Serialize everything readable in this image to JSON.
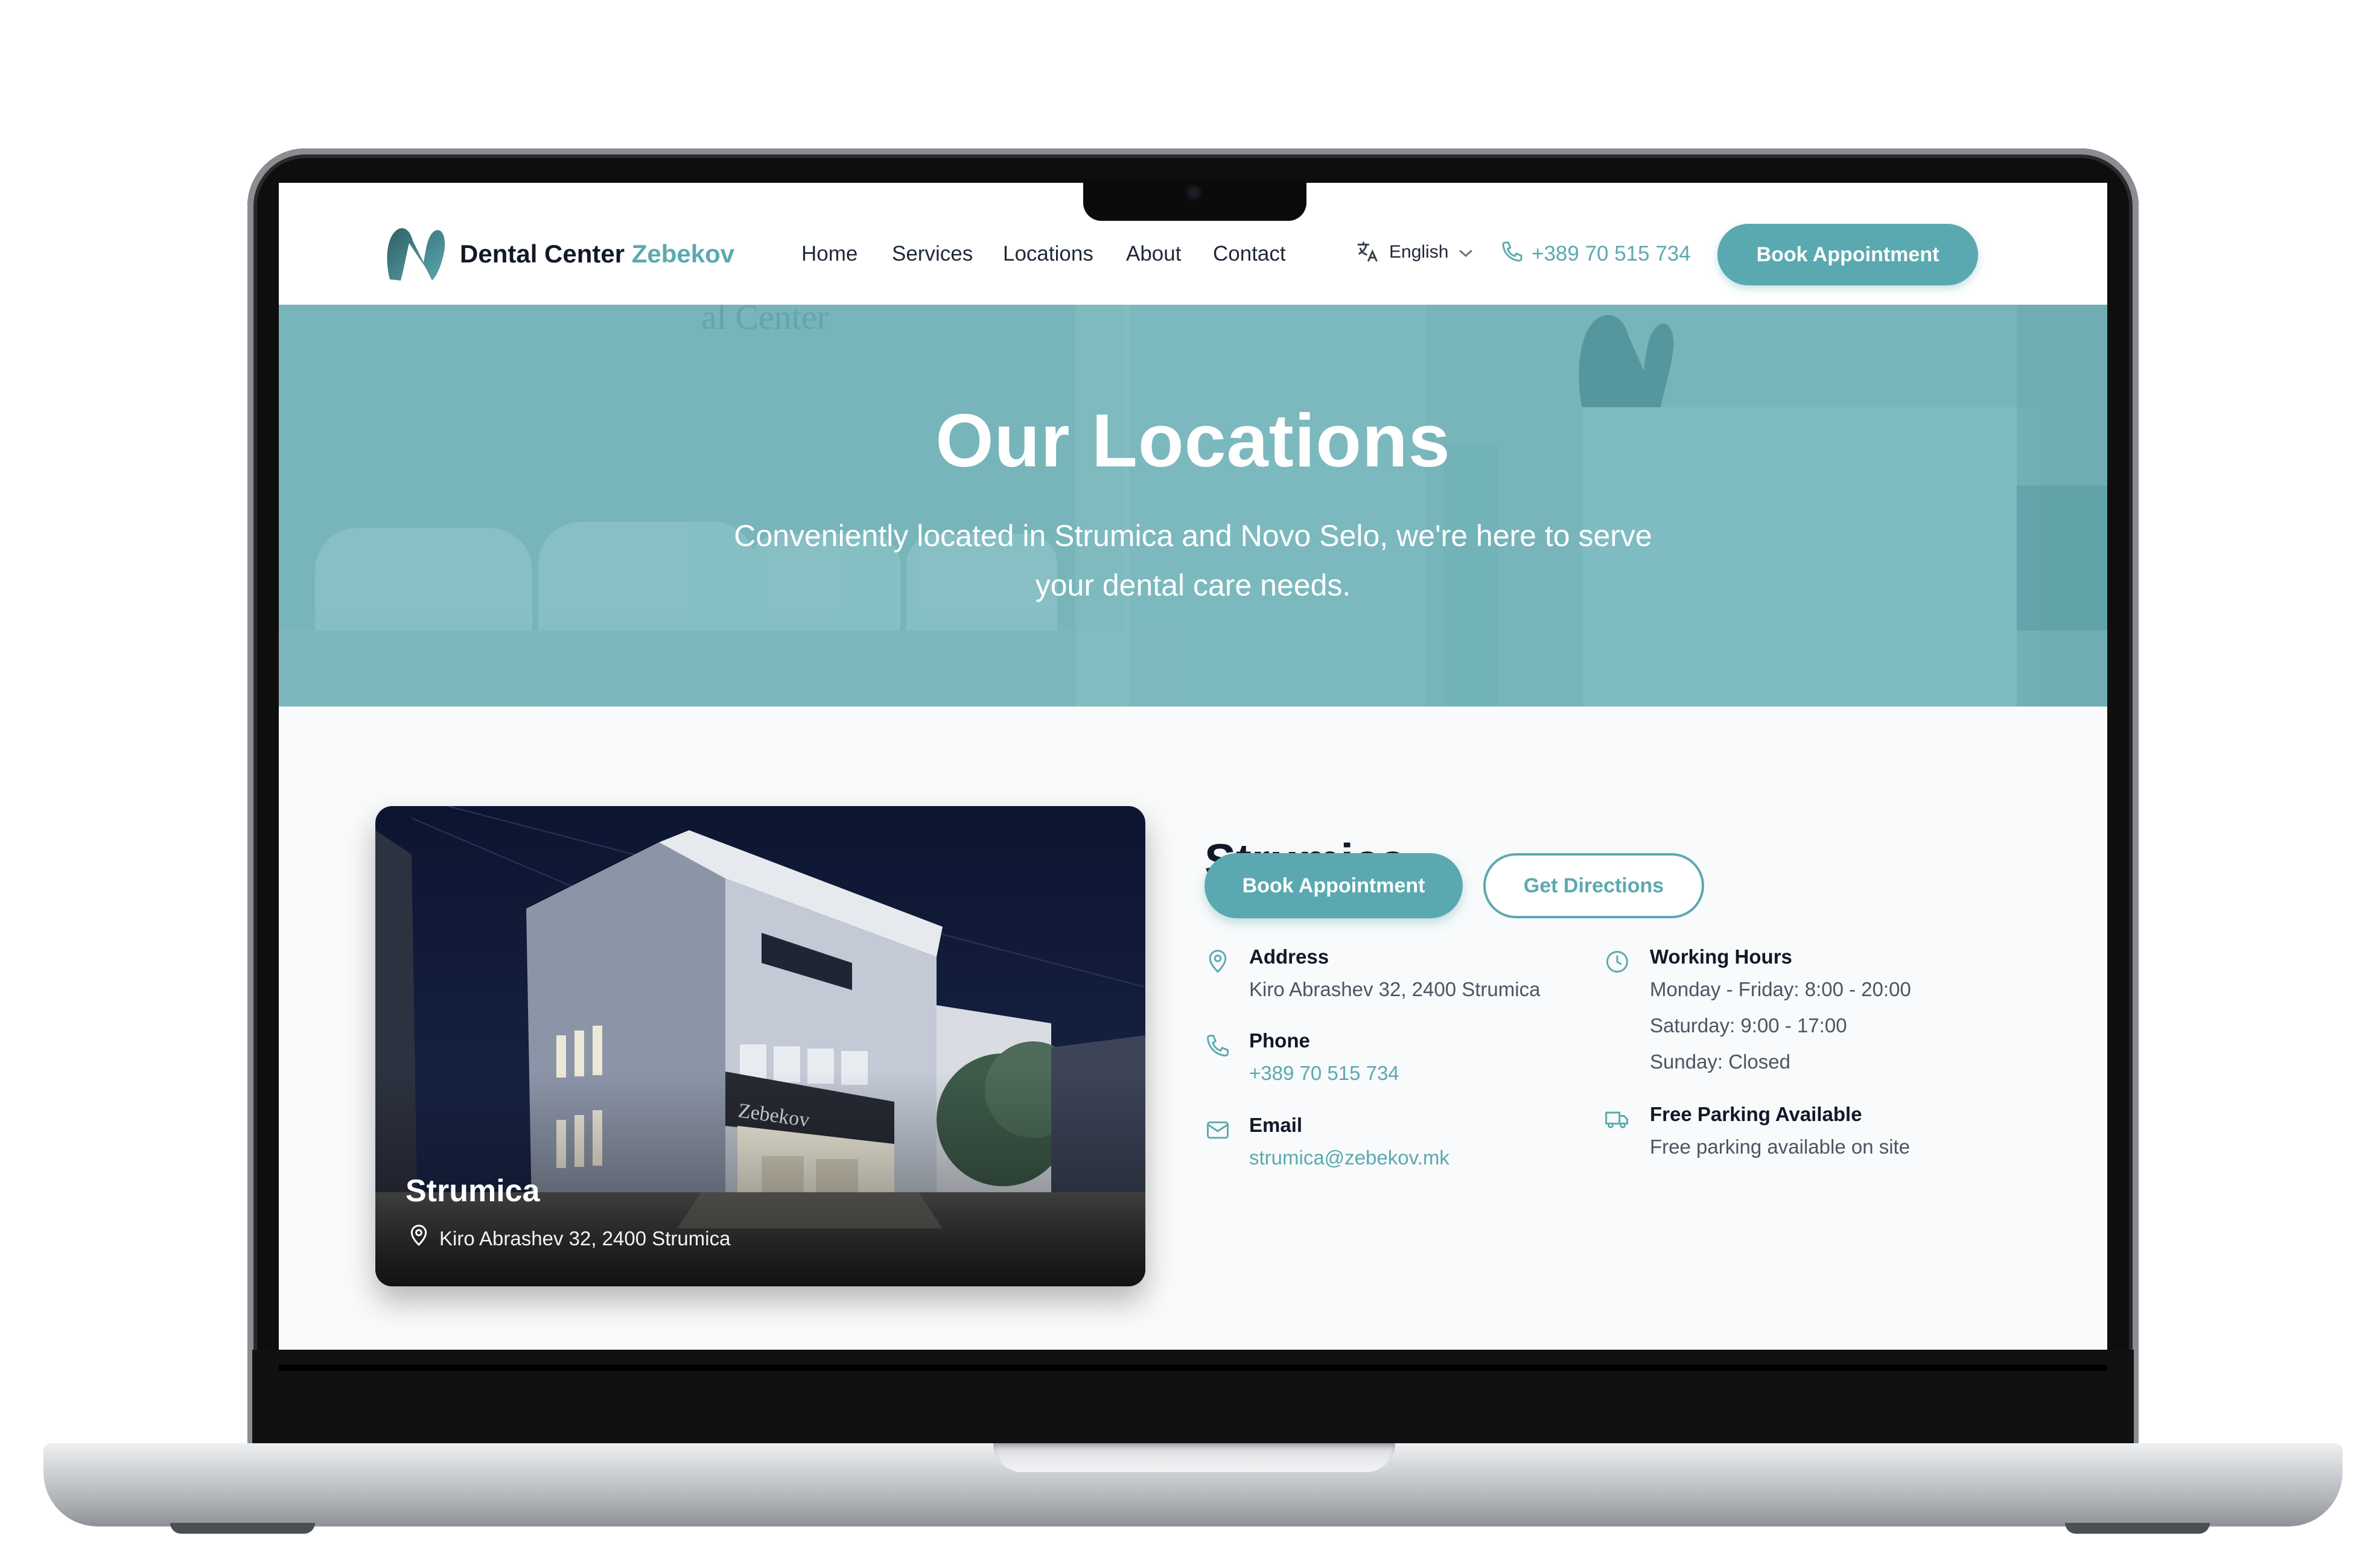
{
  "nav": {
    "brand_primary": "Dental Center",
    "brand_accent": "Zebekov",
    "menu": [
      "Home",
      "Services",
      "Locations",
      "About",
      "Contact"
    ],
    "language": "English",
    "phone": "+389 70 515 734",
    "book_label": "Book Appointment"
  },
  "hero": {
    "title": "Our Locations",
    "subtitle": "Conveniently located in Strumica and Novo Selo, we're here to serve your dental care needs."
  },
  "location": {
    "name": "Strumica",
    "photo_caption_title": "Strumica",
    "photo_caption_address": "Kiro Abrashev 32, 2400 Strumica",
    "address_label": "Address",
    "address_value": "Kiro Abrashev 32, 2400 Strumica",
    "phone_label": "Phone",
    "phone_value": "+389 70 515 734",
    "email_label": "Email",
    "email_value": "strumica@zebekov.mk",
    "hours_label": "Working Hours",
    "hours": [
      "Monday - Friday: 8:00 - 20:00",
      "Saturday: 9:00 - 17:00",
      "Sunday: Closed"
    ],
    "parking_label": "Free Parking Available",
    "parking_value": "Free parking available on site",
    "book_label": "Book Appointment",
    "directions_label": "Get Directions"
  },
  "colors": {
    "accent": "#5ba9b0",
    "hero_overlay": "#72b2b8",
    "dark_text": "#111827"
  },
  "icons": [
    "tooth-logo-icon",
    "translate-icon",
    "chevron-down-icon",
    "phone-icon",
    "map-pin-icon",
    "clock-icon",
    "mail-icon",
    "truck-icon"
  ]
}
